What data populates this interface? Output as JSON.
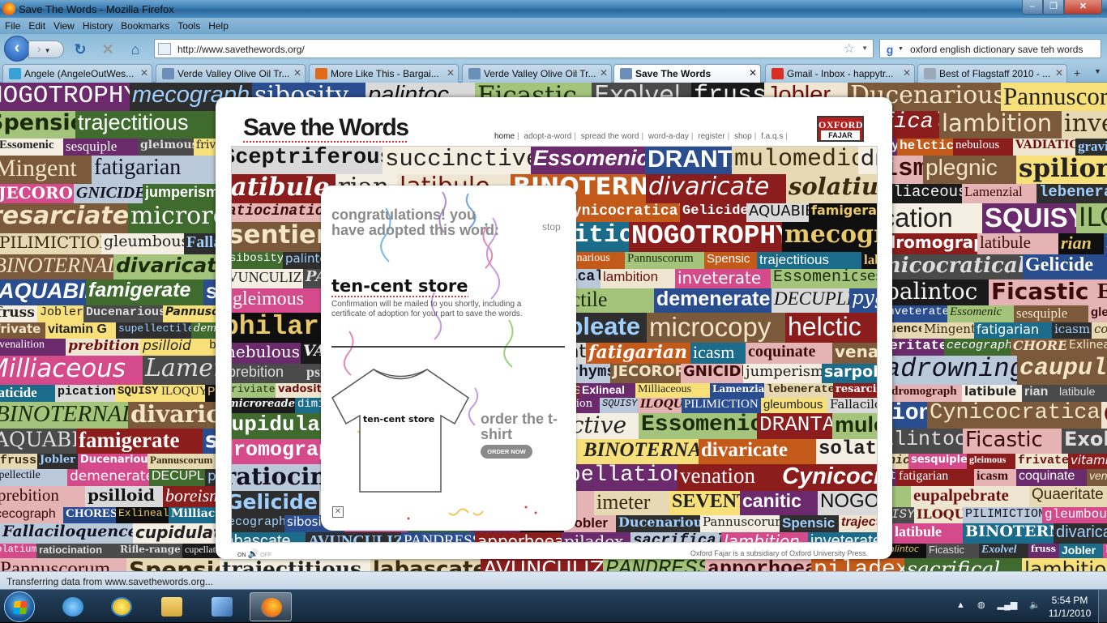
{
  "window": {
    "title": "Save The Words - Mozilla Firefox",
    "controls": {
      "min": "–",
      "max": "❐",
      "close": "✕"
    }
  },
  "menu": [
    "File",
    "Edit",
    "View",
    "History",
    "Bookmarks",
    "Tools",
    "Help"
  ],
  "nav": {
    "url": "http://www.savethewords.org/",
    "search_query": "oxford english dictionary save teh words",
    "search_engine": "g"
  },
  "tabs": [
    {
      "label": "Angele (AngeleOutWes...",
      "color": "#3aa0d8"
    },
    {
      "label": "Verde Valley Olive Oil Tr...",
      "color": "#6b8fb8"
    },
    {
      "label": "More Like This - Bargai...",
      "color": "#e06b1a"
    },
    {
      "label": "Verde Valley Olive Oil Tr...",
      "color": "#6b8fb8"
    },
    {
      "label": "Save The Words",
      "color": "#6b8fb8",
      "active": true
    },
    {
      "label": "Gmail - Inbox - happytr...",
      "color": "#d93025"
    },
    {
      "label": "Best of Flagstaff 2010 - ...",
      "color": "#9aa8b8"
    }
  ],
  "tab_controls": {
    "new_tab": "+",
    "list": "▼",
    "close": "✕"
  },
  "site": {
    "logo": "Save the Words",
    "nav": [
      "home",
      "adopt-a-word",
      "spread the word",
      "word-a-day",
      "register",
      "shop",
      "f.a.q.s"
    ],
    "publisher_top": "OXFORD",
    "publisher_bottom": "FAJAR",
    "sound_on": "ON",
    "sound_off": "OFF",
    "footnote": "Oxford Fajar is a subsidiary of Oxford University Press."
  },
  "card": {
    "heading": "congratulations! you have adopted this word:",
    "stop": "stop",
    "word": "ten-cent store",
    "confirmation": "Confirmation will be mailed to you shortly, including a certificate of adoption for your part to save the words.",
    "tshirt_text": "ten-cent store",
    "order_heading": "order the t-shirt",
    "order_button": "ORDER NOW",
    "close": "✕"
  },
  "status": "Transferring data from www.savethewords.org...",
  "taskbar": {
    "time": "5:54 PM",
    "date": "11/1/2010",
    "tray_up": "▲"
  },
  "collage_words": [
    "rian",
    "latibule",
    "BINOTERNAL",
    "divaricate",
    "solatium",
    "ratiocination",
    "Rifle-range",
    "cupellation",
    "venation",
    "Cynicocratical",
    "Gelicide",
    "AQUABIB",
    "famigerate",
    "sentient",
    "imeter",
    "SEVENT",
    "canitic",
    "NOGOTROPHY",
    "mecograph",
    "sibosity",
    "palintoc",
    "Ficastic",
    "Exolvel",
    "fruss",
    "Jobler",
    "Ducenarious",
    "Pannuscorum",
    "Spensic",
    "trajectitious",
    "labascate",
    "AVUNCULIZE",
    "PANDRESS",
    "apporhoea",
    "piladex",
    "sacrifical",
    "lambition",
    "inveterate",
    "Essomenic",
    "sesquiple",
    "gleimous",
    "frivate",
    "vitamin G",
    "supellectile",
    "demenerate",
    "DECUPLE",
    "pygnastics",
    "philargyrist",
    "gracile",
    "Adimpleate",
    "microcopy",
    "helctic",
    "nebulous",
    "VADIATION",
    "graviloquence",
    "Mingent",
    "fatigarian",
    "icasm",
    "coquinate",
    "venalition",
    "prebition",
    "psilloid",
    "boreism",
    "plegnic",
    "spiliorrhyms",
    "JECORORY",
    "GNICIDE",
    "jumperism",
    "sarpolypod",
    "riviate",
    "vadosity",
    "eupalpebrate",
    "Quaeritate",
    "cecograph",
    "CHORESS",
    "Exlineal",
    "Milliaceous",
    "Lamenzial",
    "lebenerate",
    "resarciate",
    "microreader",
    "diminipotent",
    "adrowning",
    "caupulator",
    "vaticide",
    "pication",
    "SQUISY",
    "ILOQUY",
    "PILIMICTION",
    "gleumbous",
    "Fallaciloquence",
    "cupidulate",
    "Sceptriferous",
    "succinctive",
    "Essomenic",
    "DRANTA",
    "mulomedic",
    "dromograph",
    "latibule"
  ]
}
